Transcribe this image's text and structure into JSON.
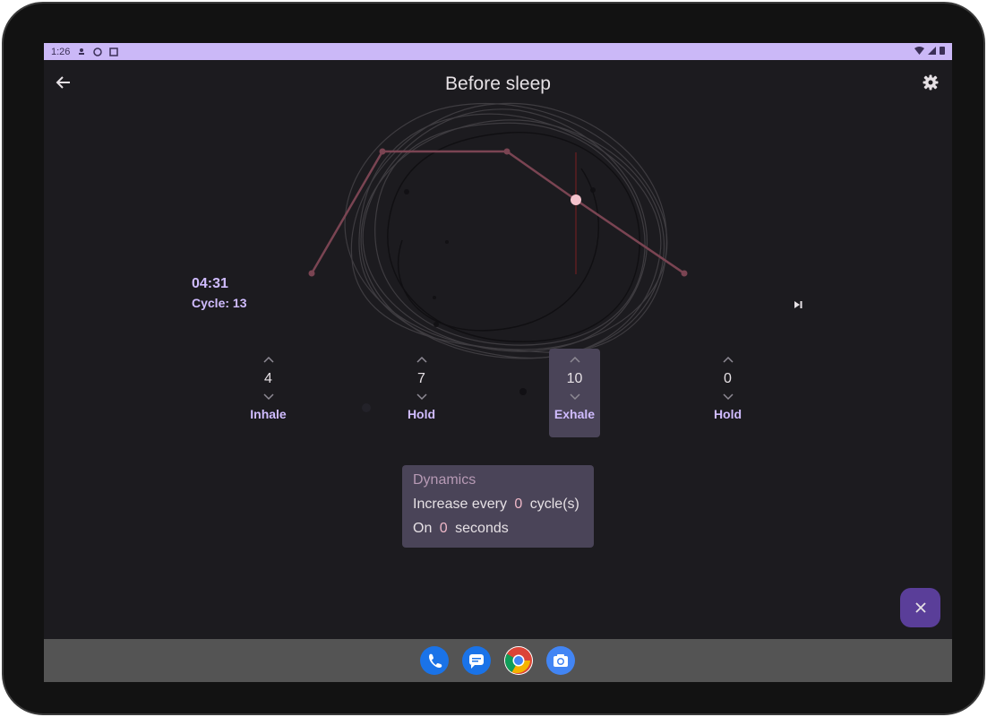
{
  "status_bar": {
    "time": "1:26"
  },
  "header": {
    "title": "Before sleep"
  },
  "timer": {
    "elapsed": "04:31",
    "cycle": "Cycle: 13"
  },
  "phases": [
    {
      "label": "Inhale",
      "value": "4",
      "active": false
    },
    {
      "label": "Hold",
      "value": "7",
      "active": false
    },
    {
      "label": "Exhale",
      "value": "10",
      "active": true
    },
    {
      "label": "Hold",
      "value": "0",
      "active": false
    }
  ],
  "dynamics": {
    "title": "Dynamics",
    "increase_prefix": "Increase every",
    "increase_value": "0",
    "increase_suffix": "cycle(s)",
    "on_prefix": "On",
    "on_value": "0",
    "on_suffix": "seconds"
  },
  "dock": [
    "phone-app",
    "messages-app",
    "chrome-app",
    "camera-app"
  ],
  "colors": {
    "accent": "#d0bcff",
    "status_bar": "#cbb8f7",
    "fab": "#5a3e99",
    "breath_line": "#7a4452",
    "indicator_dot": "#f4c2cc"
  }
}
